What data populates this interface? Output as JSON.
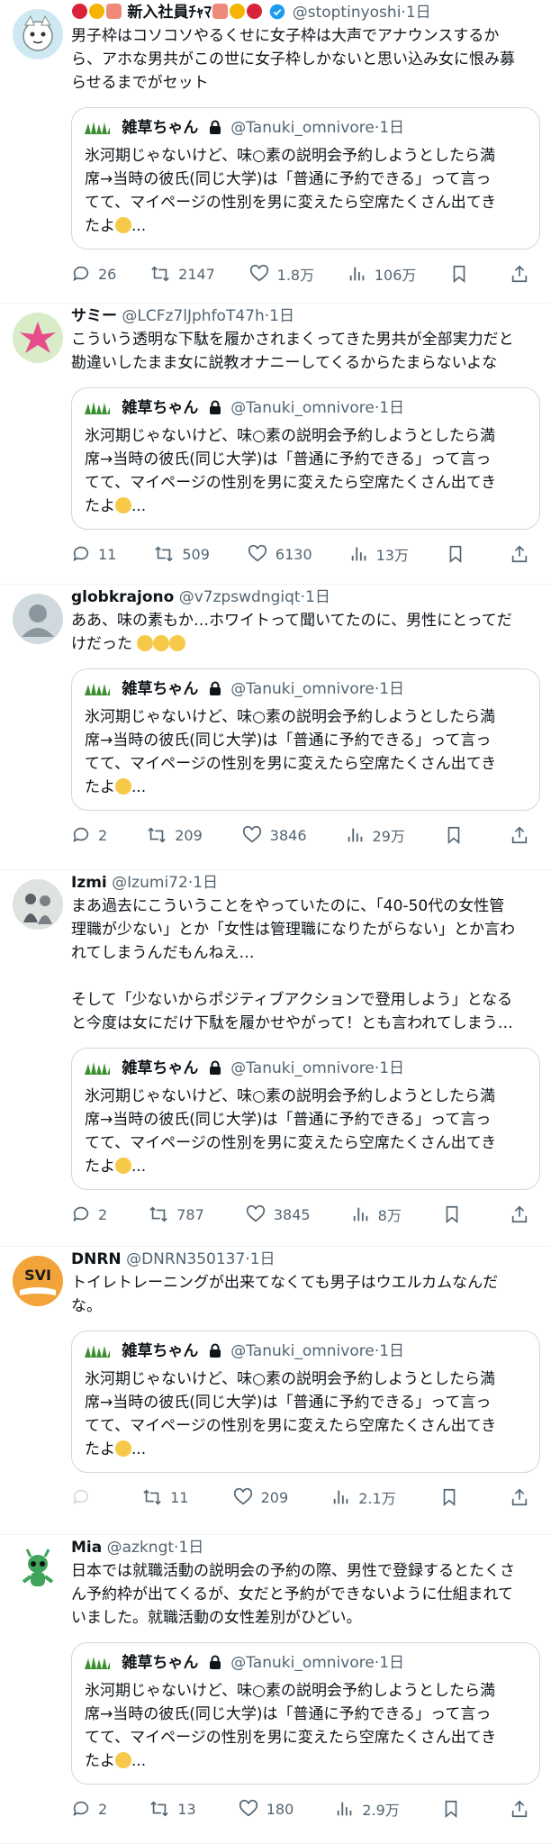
{
  "quote": {
    "name": "雑草ちゃん",
    "handle": "@Tanuki_omnivore",
    "time": "1日",
    "lines": [
      "氷河期じゃないけど、味○素の説明会予約しようとしたら満",
      "席→当時の彼氏(同じ大学)は「普通に予約できる」って言っ",
      "てて、マイページの性別を男に変えたら空席たくさん出てき",
      "たよ"
    ],
    "variant_lines_1": [
      "氷河期じゃないけど、味○素の説明会予約しようとしたら満",
      "席→当時の彼氏(同じ大学)は「普通に予約できる」って言っ",
      "てて、マイページの性別を男に変えたら空席たくさん出てき",
      "たよ"
    ],
    "ellipsis": "...",
    "variant_first_line": "氷河期じゃないけど、味○素の説明会予約しようとしたら満"
  },
  "posts": [
    {
      "name": "新入社員",
      "name_suffix": "ﾁｬﾏ",
      "handle": "@stoptinyoshi",
      "time": "1日",
      "verified": true,
      "text": "男子枠はコソコソやるくせに女子枠は大声でアナウンスするか\nら、アホな男共がこの世に女子枠しかないと思い込み女に恨み募\nらせるまでがセット",
      "quote_line1": "氷河期じゃないけど、味○素の説明会予約しようとしたら満",
      "replies": "26",
      "reposts": "2147",
      "likes": "1.8万",
      "views": "106万"
    },
    {
      "name": "サミー",
      "handle": "@LCFz7lJphfoT47h",
      "time": "1日",
      "text": "こういう透明な下駄を履かされまくってきた男共が全部実力だと\n勘違いしたまま女に説教オナニーしてくるからたまらないよな",
      "quote_line1": "氷河期じゃないけど、味○素の説明会予約しようとしたら満",
      "replies": "11",
      "reposts": "509",
      "likes": "6130",
      "views": "13万"
    },
    {
      "name": "globkrajono",
      "handle": "@v7zpswdngiqt",
      "time": "1日",
      "text": "ああ、味の素もか…ホワイトって聞いてたのに、男性にとってだ\nけだった",
      "quote_line1": "氷河期じゃないけど、味○素の説明会予約しようとしたら満",
      "replies": "2",
      "reposts": "209",
      "likes": "3846",
      "views": "29万"
    },
    {
      "name": "Izmi",
      "handle": "@Izumi72",
      "time": "1日",
      "text": "まあ過去にこういうことをやっていたのに、「40-50代の女性管\n理職が少ない」とか「女性は管理職になりたがらない」とか言わ\nれてしまうんだもんねえ…\n\nそして「少ないからポジティブアクションで登用しよう」となる\nと今度は女にだけ下駄を履かせやがって！とも言われてしまう…",
      "quote_line1": "氷河期じゃないけど、味○素の説明会予約しようとしたら満",
      "replies": "2",
      "reposts": "787",
      "likes": "3845",
      "views": "8万"
    },
    {
      "name": "DNRN",
      "handle": "@DNRN350137",
      "time": "1日",
      "text": "トイレトレーニングが出来てなくても男子はウエルカムなんだ\nな。",
      "quote_line1": "氷河期じゃないけど、味○素の説明会予約しようとしたら満",
      "replies": "",
      "reposts": "11",
      "likes": "209",
      "views": "2.1万"
    },
    {
      "name": "Mia",
      "handle": "@azkngt",
      "time": "1日",
      "text": "日本では就職活動の説明会の予約の際、男性で登録するとたくさ\nん予約枠が出てくるが、女だと予約ができないように仕組まれて\nいました。就職活動の女性差別がひどい。",
      "quote_line1": "氷河期じゃないけど、味○素の説明会予約しようとしたら満",
      "replies": "2",
      "reposts": "13",
      "likes": "180",
      "views": "2.9万"
    }
  ],
  "colors": {
    "text": "#0f1419",
    "muted": "#536471",
    "border": "#cfd9de",
    "verified": "#1d9bf0"
  }
}
